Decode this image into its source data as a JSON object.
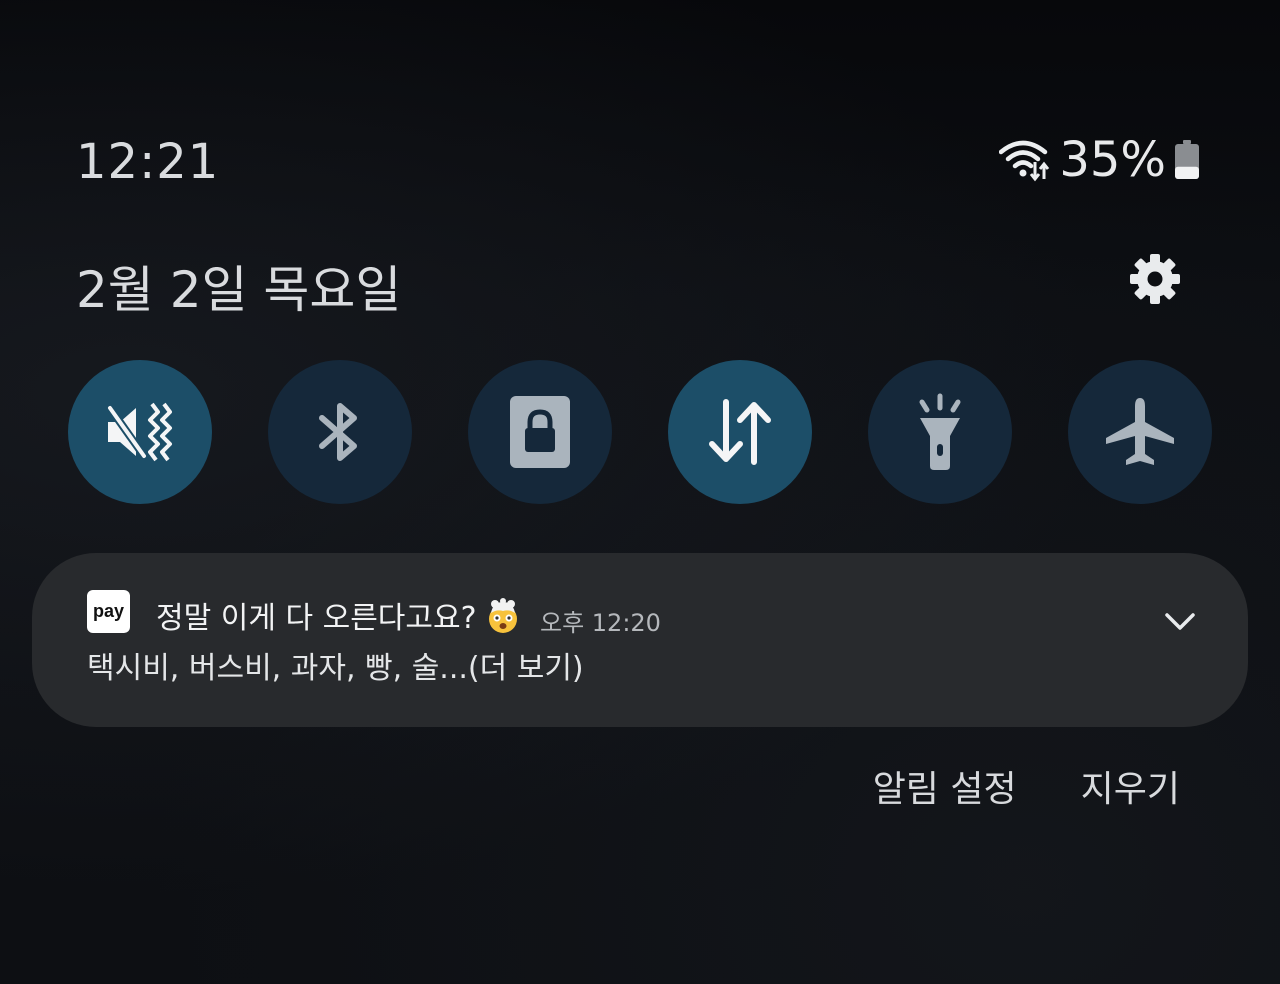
{
  "status_bar": {
    "time": "12:21",
    "battery_percent": "35%",
    "battery_level": 0.35,
    "icons": [
      "wifi-data-arrows-icon",
      "battery-icon"
    ]
  },
  "date_row": {
    "date": "2월 2일 목요일",
    "settings_icon": "gear-icon"
  },
  "quick_tiles": [
    {
      "name": "mute-vibrate",
      "icon": "mute-vibrate-icon",
      "state": "on"
    },
    {
      "name": "bluetooth",
      "icon": "bluetooth-icon",
      "state": "off"
    },
    {
      "name": "screen-lock",
      "icon": "lock-screen-icon",
      "state": "off"
    },
    {
      "name": "mobile-data",
      "icon": "data-arrows-icon",
      "state": "on"
    },
    {
      "name": "flashlight",
      "icon": "flashlight-icon",
      "state": "off"
    },
    {
      "name": "airplane-mode",
      "icon": "airplane-icon",
      "state": "off"
    }
  ],
  "notification": {
    "app_icon_text": "pay",
    "title": "정말 이게 다 오른다고요?",
    "emoji": "exploding-head-emoji",
    "time": "오후 12:20",
    "body": "택시비, 버스비, 과자, 빵, 술...(더 보기)",
    "expand_icon": "chevron-down-icon"
  },
  "actions": {
    "settings_label": "알림 설정",
    "clear_label": "지우기"
  },
  "colors": {
    "background": "#0b0d11",
    "tile_on": "#1c4e68",
    "tile_off": "#15283a",
    "card": "#282a2d"
  }
}
